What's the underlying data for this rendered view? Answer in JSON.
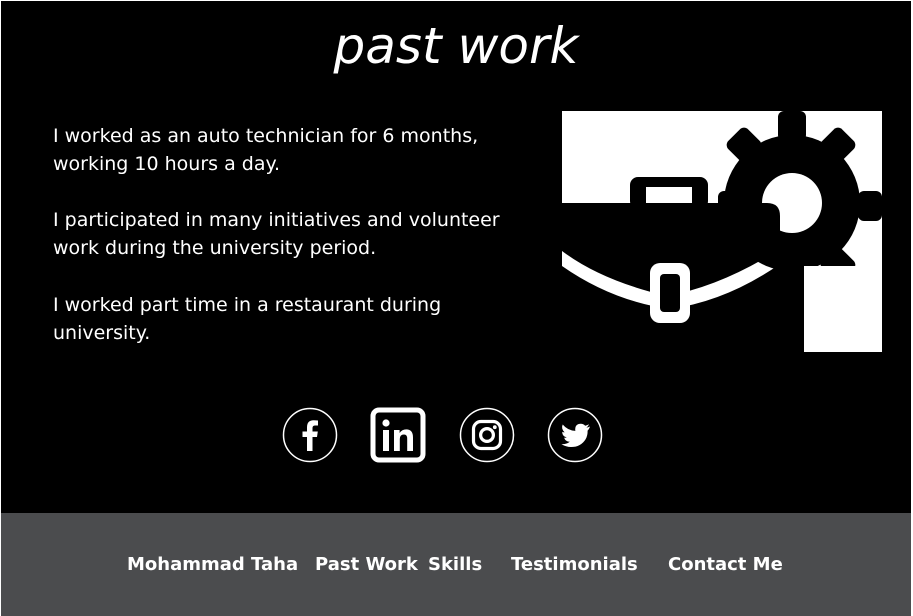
{
  "section": {
    "title": "past work",
    "paragraphs": [
      "I worked as an auto technician for 6 months, working 10 hours a day.",
      "I participated in many initiatives and volunteer work during the university period.",
      "I worked part time in a restaurant during university."
    ],
    "illustration_icon": "briefcase-gear-icon"
  },
  "social_links": [
    {
      "name": "Facebook",
      "icon": "facebook-icon"
    },
    {
      "name": "LinkedIn",
      "icon": "linkedin-icon"
    },
    {
      "name": "Instagram",
      "icon": "instagram-icon"
    },
    {
      "name": "Twitter",
      "icon": "twitter-icon"
    }
  ],
  "footer": {
    "nav": [
      "Mohammad Taha",
      "Past Work",
      "Skills",
      "Testimonials",
      "Contact Me"
    ]
  },
  "colors": {
    "background": "#000000",
    "text": "#ffffff",
    "footer_background": "#4b4c4e"
  }
}
